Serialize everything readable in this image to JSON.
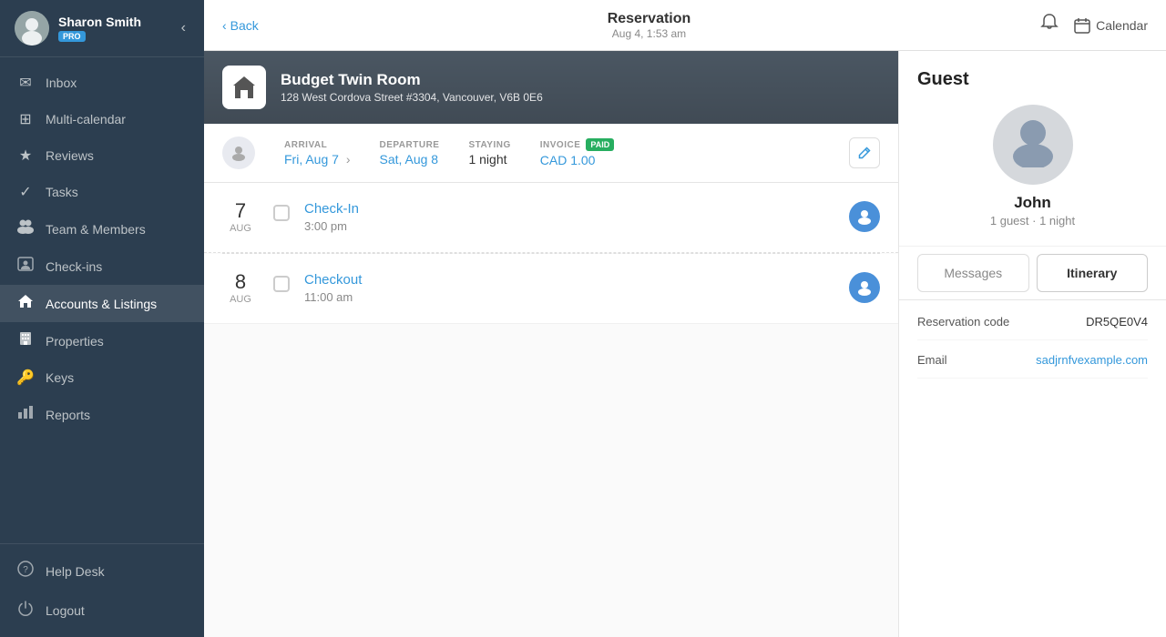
{
  "sidebar": {
    "user": {
      "name": "Sharon Smith",
      "badge": "PRO"
    },
    "nav_items": [
      {
        "id": "inbox",
        "label": "Inbox",
        "icon": "✉"
      },
      {
        "id": "multi-calendar",
        "label": "Multi-calendar",
        "icon": "⊞"
      },
      {
        "id": "reviews",
        "label": "Reviews",
        "icon": "★"
      },
      {
        "id": "tasks",
        "label": "Tasks",
        "icon": "✓"
      },
      {
        "id": "team-members",
        "label": "Team & Members",
        "icon": "👥"
      },
      {
        "id": "check-ins",
        "label": "Check-ins",
        "icon": "📋"
      },
      {
        "id": "accounts-listings",
        "label": "Accounts & Listings",
        "icon": "🏠"
      },
      {
        "id": "properties",
        "label": "Properties",
        "icon": "🏢"
      },
      {
        "id": "keys",
        "label": "Keys",
        "icon": "🔑"
      },
      {
        "id": "reports",
        "label": "Reports",
        "icon": "📊"
      }
    ],
    "footer_items": [
      {
        "id": "help-desk",
        "label": "Help Desk",
        "icon": "❓"
      },
      {
        "id": "logout",
        "label": "Logout",
        "icon": "⏻"
      }
    ]
  },
  "topbar": {
    "back_label": "Back",
    "title": "Reservation",
    "subtitle": "Aug 4, 1:53 am",
    "calendar_label": "Calendar"
  },
  "property": {
    "name": "Budget Twin Room",
    "address": "128 West Cordova Street #3304, Vancouver, V6B 0E6"
  },
  "reservation": {
    "arrival_label": "ARRIVAL",
    "arrival_value": "Fri, Aug 7",
    "departure_label": "DEPARTURE",
    "departure_value": "Sat, Aug 8",
    "staying_label": "STAYING",
    "staying_value": "1 night",
    "invoice_label": "INVOICE",
    "invoice_value": "CAD 1.00",
    "paid_badge": "PAID"
  },
  "itinerary": {
    "items": [
      {
        "day_num": "7",
        "day_month": "AUG",
        "title": "Check-In",
        "time": "3:00 pm"
      },
      {
        "day_num": "8",
        "day_month": "AUG",
        "title": "Checkout",
        "time": "11:00 am"
      }
    ]
  },
  "guest": {
    "section_title": "Guest",
    "name": "John",
    "meta": "1 guest · 1 night",
    "tabs": [
      {
        "id": "messages",
        "label": "Messages"
      },
      {
        "id": "itinerary",
        "label": "Itinerary",
        "active": true
      }
    ],
    "reservation_code_label": "Reservation code",
    "reservation_code_value": "DR5QE0V4",
    "email_label": "Email",
    "email_value": "sadjrnfvexample.com"
  }
}
